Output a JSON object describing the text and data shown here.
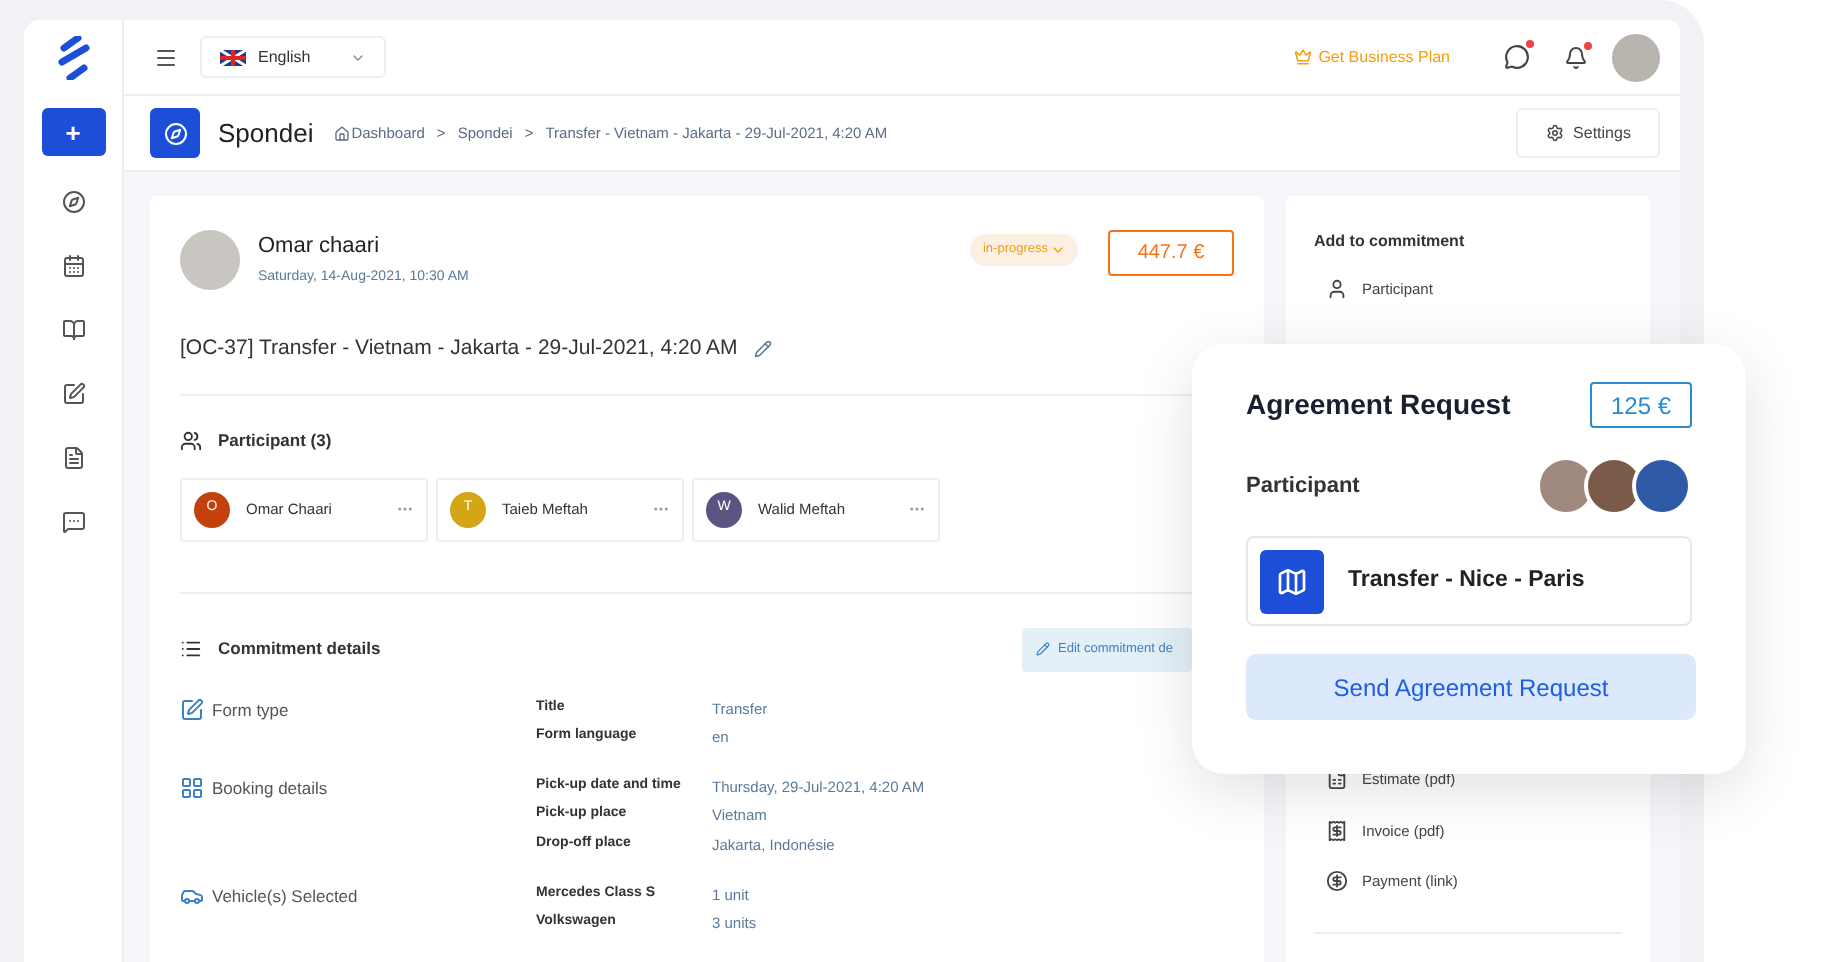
{
  "topbar": {
    "language": "English",
    "upgrade": "Get Business Plan",
    "messages_unread": true,
    "notifications_unread": true
  },
  "sidebar": {
    "new_button": "+"
  },
  "header": {
    "title": "Spondei",
    "breadcrumb": [
      "Dashboard",
      "Spondei",
      "Transfer - Vietnam - Jakarta - 29-Jul-2021, 4:20 AM"
    ],
    "separator": ">",
    "settings": "Settings"
  },
  "commitment": {
    "author": "Omar chaari",
    "date": "Saturday, 14-Aug-2021, 10:30 AM",
    "status": "in-progress",
    "price": "447.7 €",
    "title": "[OC-37] Transfer - Vietnam - Jakarta - 29-Jul-2021, 4:20 AM",
    "participants_heading": "Participant (3)",
    "participants": [
      {
        "initial": "O",
        "name": "Omar Chaari",
        "color": "#c2410c"
      },
      {
        "initial": "T",
        "name": "Taieb Meftah",
        "color": "#d4a514"
      },
      {
        "initial": "W",
        "name": "Walid Meftah",
        "color": "#5b5483"
      }
    ],
    "details_heading": "Commitment details",
    "edit_button": "Edit commitment de",
    "sections": [
      {
        "kind": "form",
        "label": "Form type",
        "fields": [
          {
            "label": "Title",
            "value": "Transfer"
          },
          {
            "label": "Form language",
            "value": "en"
          }
        ]
      },
      {
        "kind": "booking",
        "label": "Booking details",
        "fields": [
          {
            "label": "Pick-up date and time",
            "value": "Thursday, 29-Jul-2021, 4:20 AM"
          },
          {
            "label": "Pick-up place",
            "value": "Vietnam"
          },
          {
            "label": "Drop-off place",
            "value": "Jakarta, Indonésie"
          }
        ]
      },
      {
        "kind": "vehicle",
        "label": "Vehicle(s) Selected",
        "fields": [
          {
            "label": "Mercedes Class S",
            "value": "1 unit"
          },
          {
            "label": "Volkswagen",
            "value": "3 units"
          }
        ]
      }
    ]
  },
  "add_panel": {
    "heading": "Add to commitment",
    "items": [
      {
        "kind": "participant",
        "label": "Participant"
      },
      {
        "kind": "estimate",
        "label": "Estimate (pdf)"
      },
      {
        "kind": "invoice",
        "label": "Invoice (pdf)"
      },
      {
        "kind": "payment",
        "label": "Payment (link)"
      }
    ]
  },
  "agreement": {
    "title": "Agreement Request",
    "price": "125 €",
    "participant_label": "Participant",
    "commitment": "Transfer - Nice - Paris",
    "button": "Send Agreement Request"
  }
}
